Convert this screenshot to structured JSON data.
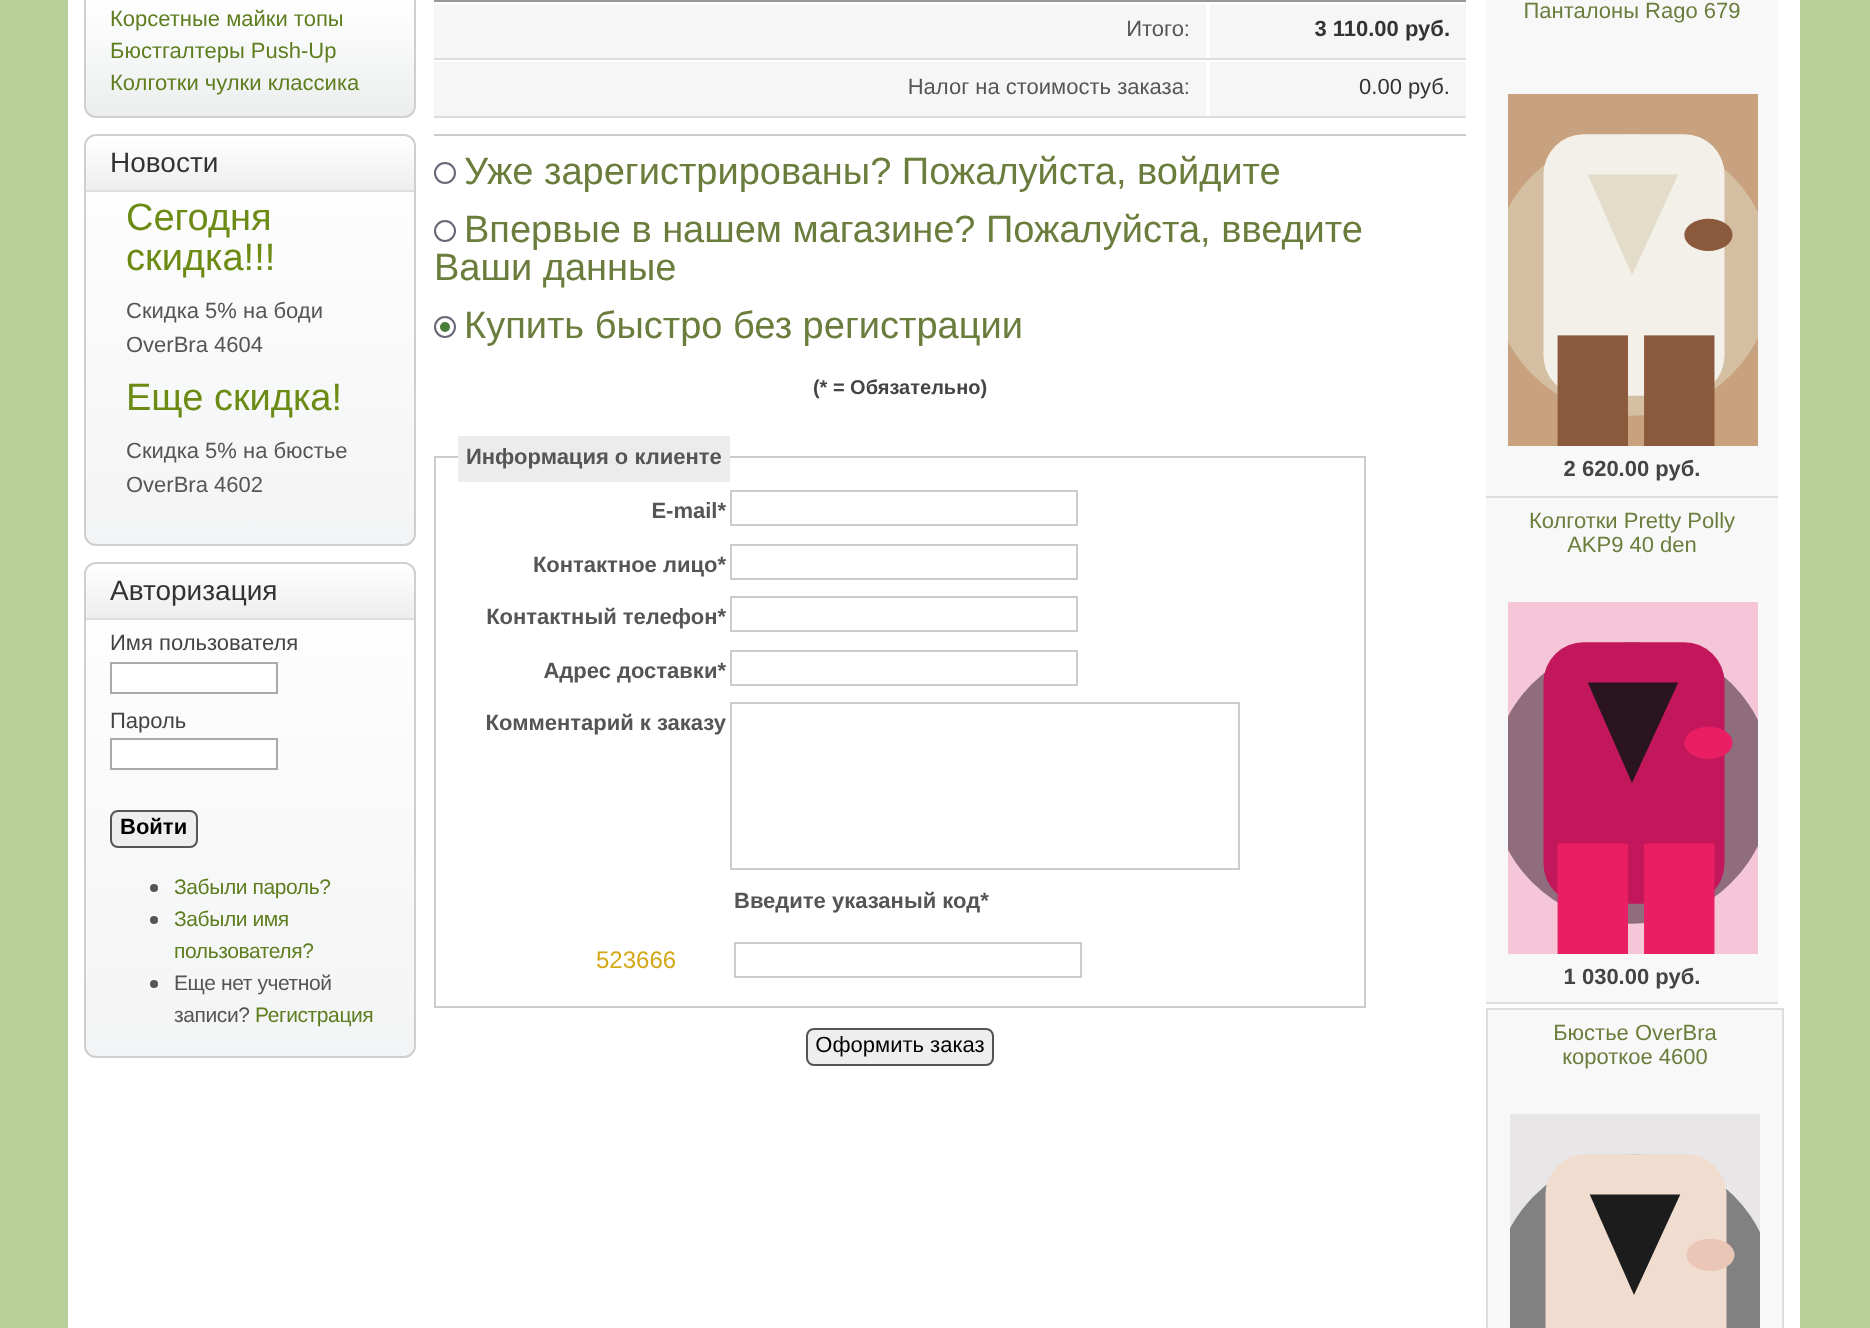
{
  "left_menu": {
    "items": [
      "Корсетные майки топы",
      "Бюстгалтеры Push-Up",
      "Колготки чулки классика"
    ]
  },
  "news": {
    "title": "Новости",
    "entries": [
      {
        "headline": "Сегодня скидка!!!",
        "text": "Скидка 5% на боди OverBra 4604"
      },
      {
        "headline": "Еще скидка!",
        "text": "Скидка 5% на бюстье OverBra 4602"
      }
    ]
  },
  "login": {
    "title": "Авторизация",
    "username_label": "Имя пользователя",
    "password_label": "Пароль",
    "submit": "Войти",
    "links": [
      {
        "kind": "link",
        "text": "Забыли пароль?"
      },
      {
        "kind": "link",
        "text": "Забыли имя пользователя?"
      },
      {
        "kind": "mixed",
        "text": "Еще нет учетной записи?",
        "link": "Регистрация"
      }
    ]
  },
  "totals": [
    {
      "label": "Итого:",
      "value": "3 110.00 руб.",
      "bold": true
    },
    {
      "label": "Налог на стоимость заказа:",
      "value": "0.00 руб.",
      "bold": false
    }
  ],
  "checkout_options": [
    {
      "label": "Уже зарегистрированы? Пожалуйста, войдите",
      "selected": false
    },
    {
      "label": "Впервые в нашем магазине? Пожалуйста, введите Ваши данные",
      "selected": false
    },
    {
      "label": "Купить быстро без регистрации",
      "selected": true
    }
  ],
  "required_note": "(* = Обязательно)",
  "customer_form": {
    "legend": "Информация о клиенте",
    "fields": [
      {
        "label": "E-mail*",
        "kind": "text"
      },
      {
        "label": "Контактное лицо*",
        "kind": "text"
      },
      {
        "label": "Контактный телефон*",
        "kind": "text"
      },
      {
        "label": "Адрес доставки*",
        "kind": "text"
      },
      {
        "label": "Комментарий к заказу",
        "kind": "textarea"
      }
    ],
    "captcha_label": "Введите указаный код*",
    "captcha_code": "523666"
  },
  "submit": "Оформить заказ",
  "products": [
    {
      "title": "Панталоны Rago 679",
      "price": "2 620.00 руб.",
      "boxed": false
    },
    {
      "title": "Колготки Pretty Polly AKP9 40 den",
      "price": "1 030.00 руб.",
      "boxed": false
    },
    {
      "title": "Бюстье OverBra короткое 4600",
      "boxed": true
    }
  ]
}
